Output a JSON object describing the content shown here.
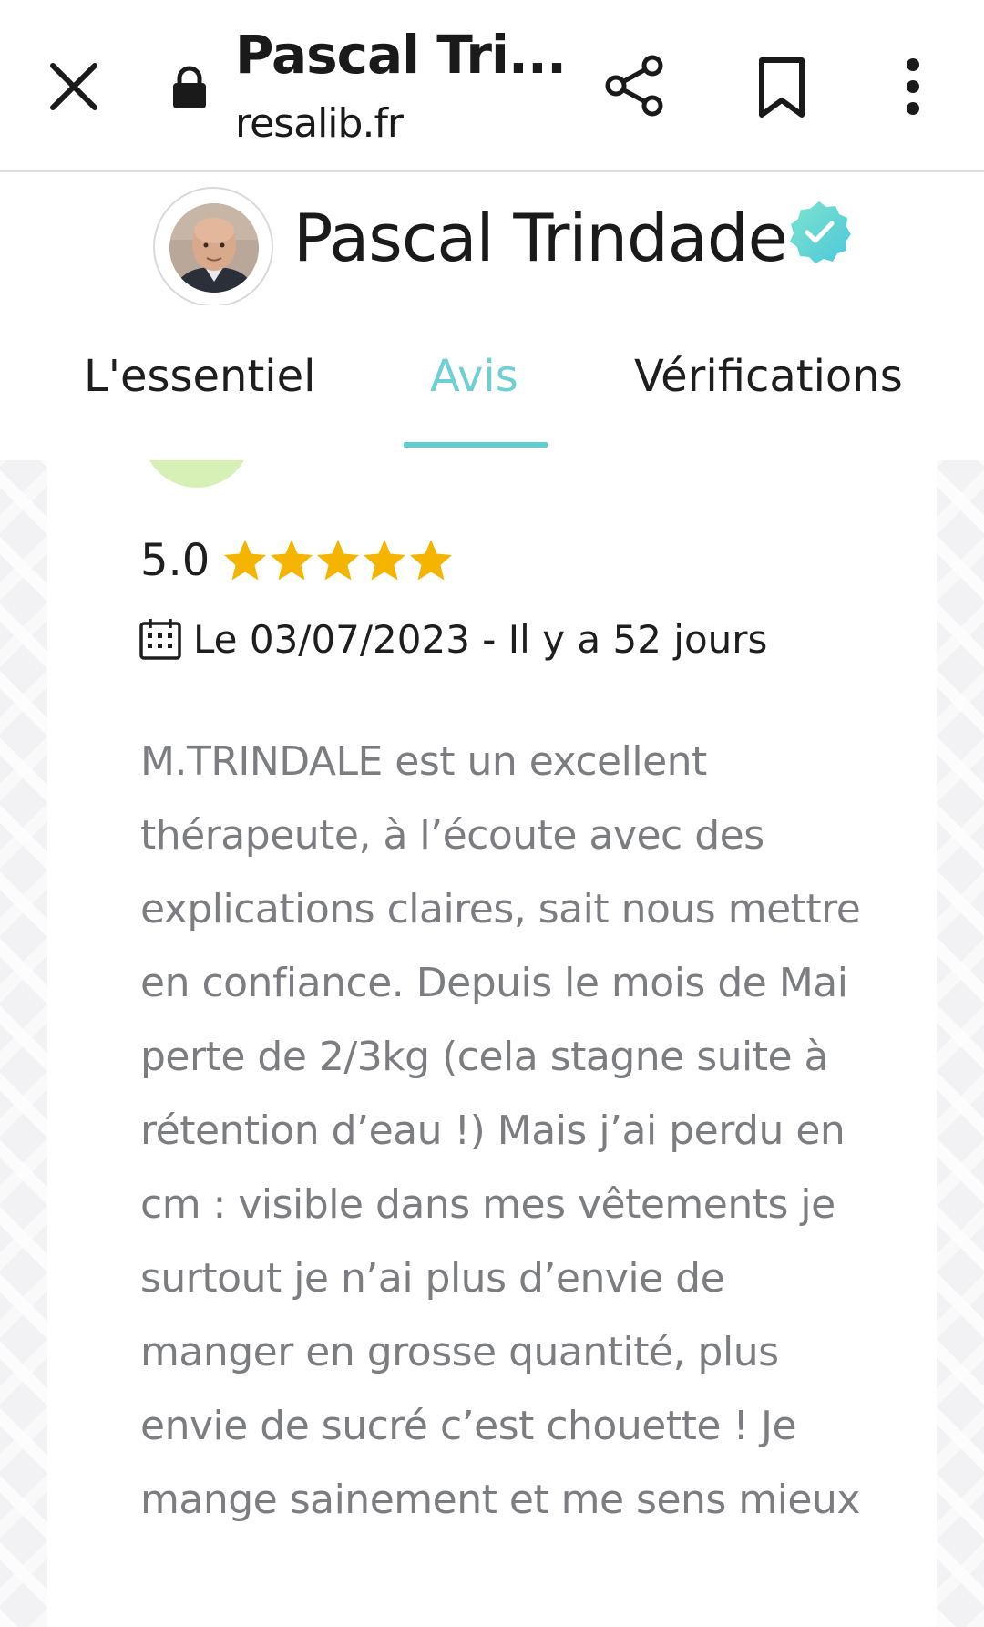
{
  "browser": {
    "title": "Pascal Tri...",
    "domain": "resalib.fr"
  },
  "profile": {
    "name": "Pascal Trindade"
  },
  "tabs": [
    {
      "label": "L'essentiel",
      "active": false
    },
    {
      "label": "Avis",
      "active": true
    },
    {
      "label": "Vérifications",
      "active": false
    }
  ],
  "review": {
    "rating": "5.0",
    "stars": 5,
    "date": "Le 03/07/2023 - Il y a 52 jours",
    "text": "M.TRINDALE est un excellent thérapeute, à l’écoute avec des explications claires, sait nous mettre en confiance. Depuis le mois de Mai perte de 2/3kg (cela stagne suite à rétention d’eau !) Mais j’ai perdu en cm : visible dans mes vêtements je surtout je n’ai plus d’envie de manger en grosse quantité, plus envie de sucré c’est chouette ! Je mange sainement et me sens mieux"
  },
  "colors": {
    "accent": "#5fcfd3",
    "star": "#f5b400",
    "review_text": "#7b7d80"
  },
  "icons": {
    "close": "close-icon",
    "lock": "lock-icon",
    "share": "share-icon",
    "bookmark": "bookmark-icon",
    "menu": "more-vert-icon",
    "verified": "verified-badge-icon",
    "calendar": "calendar-icon",
    "star": "star-icon"
  }
}
